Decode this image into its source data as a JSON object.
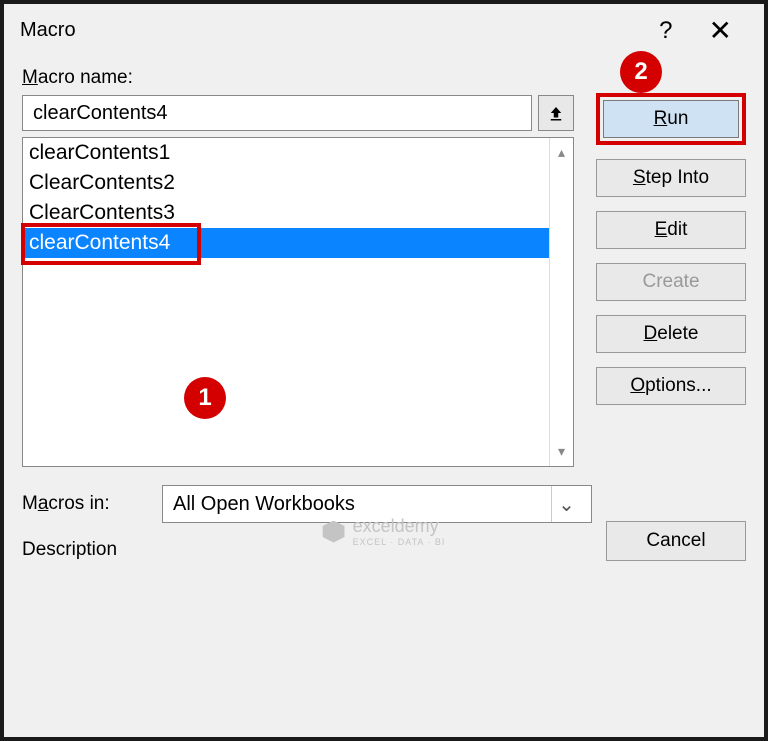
{
  "title": "Macro",
  "labels": {
    "macro_name": "Macro name:",
    "macros_in": "Macros in:",
    "description": "Description"
  },
  "name_input": "clearContents4",
  "macro_list": [
    "clearContents1",
    "ClearContents2",
    "ClearContents3",
    "clearContents4"
  ],
  "selected_index": 3,
  "macros_in_value": "All Open Workbooks",
  "buttons": {
    "run": "Run",
    "step_into": "Step Into",
    "edit": "Edit",
    "create": "Create",
    "delete": "Delete",
    "options": "Options...",
    "cancel": "Cancel"
  },
  "badges": {
    "one": "1",
    "two": "2"
  },
  "watermark": {
    "name": "exceldemy",
    "sub": "EXCEL · DATA · BI"
  }
}
